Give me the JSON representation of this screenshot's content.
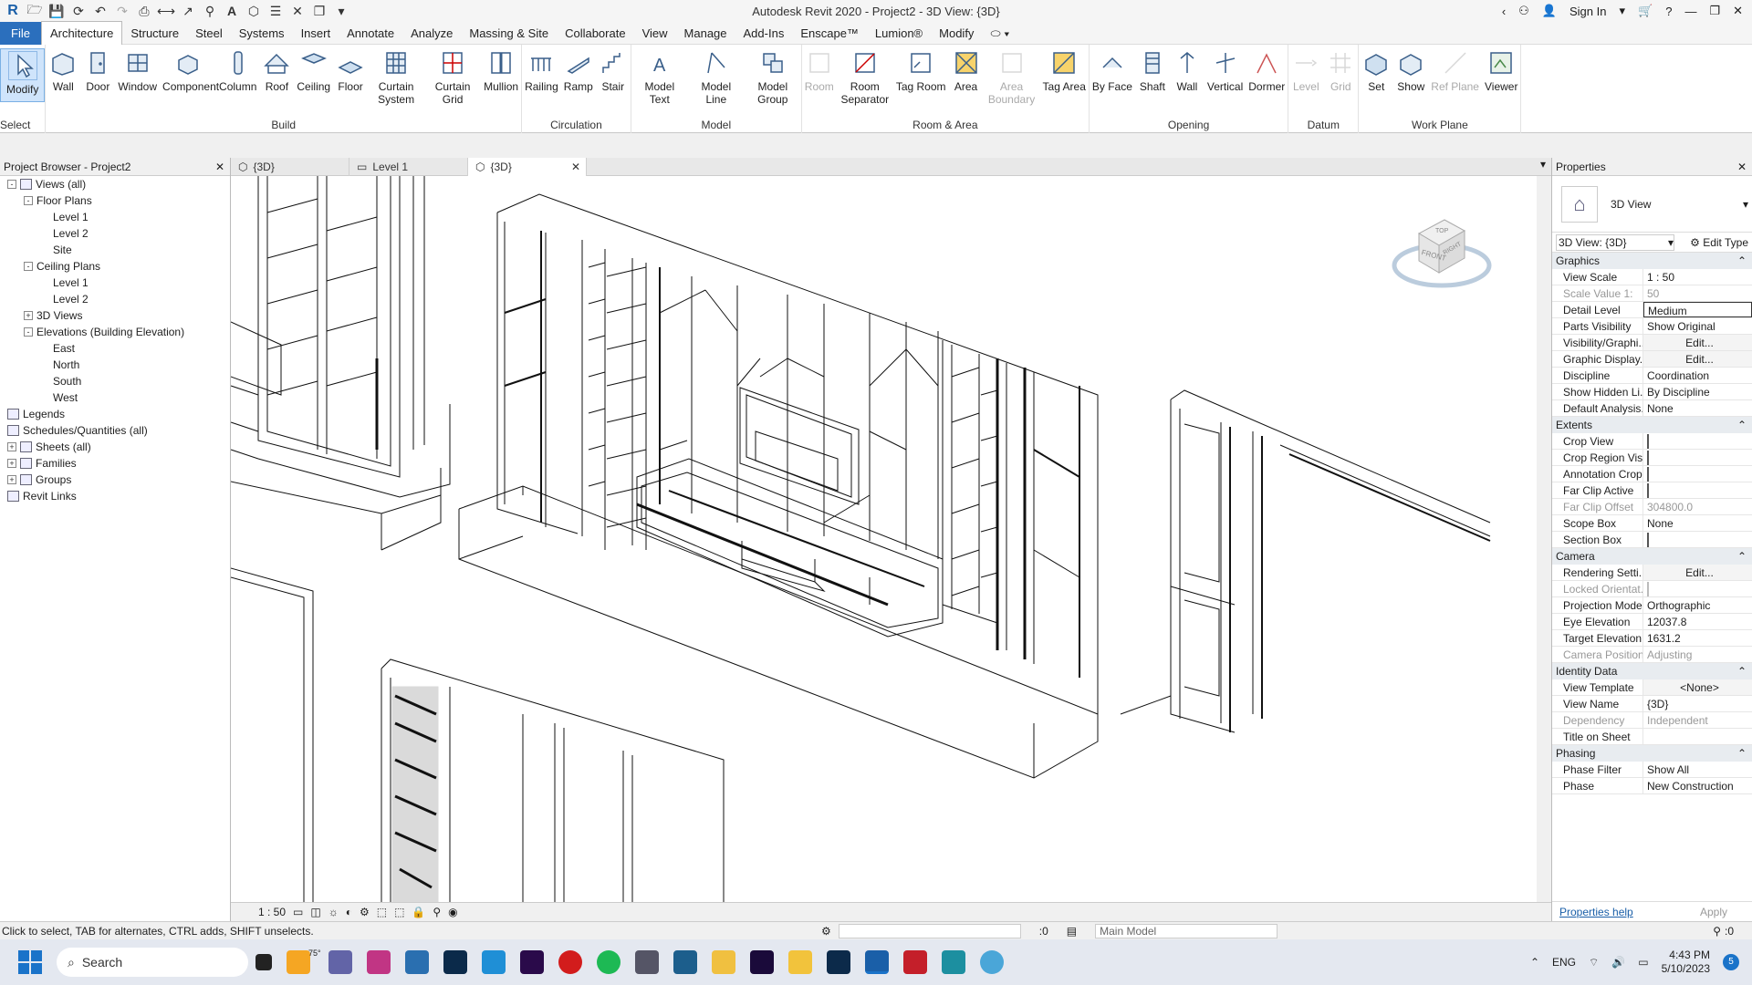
{
  "app_title": "Autodesk Revit 2020 - Project2 - 3D View: {3D}",
  "signin": "Sign In",
  "menu": [
    "File",
    "Architecture",
    "Structure",
    "Steel",
    "Systems",
    "Insert",
    "Annotate",
    "Analyze",
    "Massing & Site",
    "Collaborate",
    "View",
    "Manage",
    "Add-Ins",
    "Enscape™",
    "Lumion®",
    "Modify"
  ],
  "ribbon": {
    "select_label": "Select",
    "panels": [
      {
        "name": "",
        "tools": [
          {
            "label": "Modify",
            "icon": "cursor-icon"
          }
        ]
      },
      {
        "name": "Build",
        "tools": [
          {
            "label": "Wall",
            "icon": "wall-icon"
          },
          {
            "label": "Door",
            "icon": "door-icon"
          },
          {
            "label": "Window",
            "icon": "window-icon"
          },
          {
            "label": "Component",
            "icon": "component-icon"
          },
          {
            "label": "Column",
            "icon": "column-icon"
          },
          {
            "label": "Roof",
            "icon": "roof-icon"
          },
          {
            "label": "Ceiling",
            "icon": "ceiling-icon"
          },
          {
            "label": "Floor",
            "icon": "floor-icon"
          },
          {
            "label": "Curtain System",
            "icon": "curtain-system-icon"
          },
          {
            "label": "Curtain Grid",
            "icon": "curtain-grid-icon"
          },
          {
            "label": "Mullion",
            "icon": "mullion-icon"
          }
        ]
      },
      {
        "name": "Circulation",
        "tools": [
          {
            "label": "Railing",
            "icon": "railing-icon"
          },
          {
            "label": "Ramp",
            "icon": "ramp-icon"
          },
          {
            "label": "Stair",
            "icon": "stair-icon"
          }
        ]
      },
      {
        "name": "Model",
        "tools": [
          {
            "label": "Model Text",
            "icon": "model-text-icon"
          },
          {
            "label": "Model Line",
            "icon": "model-line-icon"
          },
          {
            "label": "Model Group",
            "icon": "model-group-icon"
          }
        ]
      },
      {
        "name": "Room & Area",
        "tools": [
          {
            "label": "Room",
            "icon": "room-icon",
            "disabled": true
          },
          {
            "label": "Room Separator",
            "icon": "room-separator-icon"
          },
          {
            "label": "Tag Room",
            "icon": "tag-room-icon"
          },
          {
            "label": "Area",
            "icon": "area-icon"
          },
          {
            "label": "Area Boundary",
            "icon": "area-boundary-icon",
            "disabled": true
          },
          {
            "label": "Tag Area",
            "icon": "tag-area-icon"
          }
        ]
      },
      {
        "name": "Opening",
        "tools": [
          {
            "label": "By Face",
            "icon": "by-face-icon"
          },
          {
            "label": "Shaft",
            "icon": "shaft-icon"
          },
          {
            "label": "Wall",
            "icon": "wall-opening-icon"
          },
          {
            "label": "Vertical",
            "icon": "vertical-icon"
          },
          {
            "label": "Dormer",
            "icon": "dormer-icon"
          }
        ]
      },
      {
        "name": "Datum",
        "tools": [
          {
            "label": "Level",
            "icon": "level-icon",
            "disabled": true
          },
          {
            "label": "Grid",
            "icon": "grid-icon",
            "disabled": true
          }
        ]
      },
      {
        "name": "Work Plane",
        "tools": [
          {
            "label": "Set",
            "icon": "set-icon"
          },
          {
            "label": "Show",
            "icon": "show-icon"
          },
          {
            "label": "Ref Plane",
            "icon": "ref-plane-icon",
            "disabled": true
          },
          {
            "label": "Viewer",
            "icon": "viewer-icon"
          }
        ]
      }
    ]
  },
  "browser": {
    "title": "Project Browser - Project2",
    "items": [
      {
        "label": "Views (all)",
        "level": 0,
        "toggle": "-"
      },
      {
        "label": "Floor Plans",
        "level": 1,
        "toggle": "-"
      },
      {
        "label": "Level 1",
        "level": 2
      },
      {
        "label": "Level 2",
        "level": 2
      },
      {
        "label": "Site",
        "level": 2
      },
      {
        "label": "Ceiling Plans",
        "level": 1,
        "toggle": "-"
      },
      {
        "label": "Level 1",
        "level": 2
      },
      {
        "label": "Level 2",
        "level": 2
      },
      {
        "label": "3D Views",
        "level": 1,
        "toggle": "+"
      },
      {
        "label": "Elevations (Building Elevation)",
        "level": 1,
        "toggle": "-"
      },
      {
        "label": "East",
        "level": 2
      },
      {
        "label": "North",
        "level": 2
      },
      {
        "label": "South",
        "level": 2
      },
      {
        "label": "West",
        "level": 2
      },
      {
        "label": "Legends",
        "level": 0,
        "icon": true
      },
      {
        "label": "Schedules/Quantities (all)",
        "level": 0,
        "icon": true
      },
      {
        "label": "Sheets (all)",
        "level": 0,
        "icon": true,
        "toggle": "+"
      },
      {
        "label": "Families",
        "level": 0,
        "icon": true,
        "toggle": "+"
      },
      {
        "label": "Groups",
        "level": 0,
        "icon": true,
        "toggle": "+"
      },
      {
        "label": "Revit Links",
        "level": 0,
        "icon": true
      }
    ]
  },
  "view_tabs": [
    "{3D}",
    "Level 1",
    "{3D}"
  ],
  "view_scale": "1 : 50",
  "properties": {
    "title": "Properties",
    "type_name": "3D View",
    "selector": "3D View: {3D}",
    "edit_type": "Edit Type",
    "sections": [
      {
        "name": "Graphics",
        "rows": [
          {
            "k": "View Scale",
            "v": "1 : 50"
          },
          {
            "k": "Scale Value    1:",
            "v": "50",
            "dis": true
          },
          {
            "k": "Detail Level",
            "v": "Medium"
          },
          {
            "k": "Parts Visibility",
            "v": "Show Original"
          },
          {
            "k": "Visibility/Graphi...",
            "v": "Edit...",
            "btn": true
          },
          {
            "k": "Graphic Display...",
            "v": "Edit...",
            "btn": true
          },
          {
            "k": "Discipline",
            "v": "Coordination"
          },
          {
            "k": "Show Hidden Li...",
            "v": "By Discipline"
          },
          {
            "k": "Default Analysis...",
            "v": "None"
          }
        ]
      },
      {
        "name": "Extents",
        "rows": [
          {
            "k": "Crop View",
            "v": "",
            "cb": true
          },
          {
            "k": "Crop Region Vis...",
            "v": "",
            "cb": true
          },
          {
            "k": "Annotation Crop",
            "v": "",
            "cb": true
          },
          {
            "k": "Far Clip Active",
            "v": "",
            "cb": true
          },
          {
            "k": "Far Clip Offset",
            "v": "304800.0",
            "dis": true
          },
          {
            "k": "Scope Box",
            "v": "None"
          },
          {
            "k": "Section Box",
            "v": "",
            "cb": true
          }
        ]
      },
      {
        "name": "Camera",
        "rows": [
          {
            "k": "Rendering Setti...",
            "v": "Edit...",
            "btn": true
          },
          {
            "k": "Locked Orientat...",
            "v": "",
            "cb": true,
            "dis": true
          },
          {
            "k": "Projection Mode",
            "v": "Orthographic"
          },
          {
            "k": "Eye Elevation",
            "v": "12037.8"
          },
          {
            "k": "Target Elevation",
            "v": "1631.2"
          },
          {
            "k": "Camera Position",
            "v": "Adjusting",
            "dis": true
          }
        ]
      },
      {
        "name": "Identity Data",
        "rows": [
          {
            "k": "View Template",
            "v": "<None>",
            "btn": true
          },
          {
            "k": "View Name",
            "v": "{3D}"
          },
          {
            "k": "Dependency",
            "v": "Independent",
            "dis": true
          },
          {
            "k": "Title on Sheet",
            "v": ""
          }
        ]
      },
      {
        "name": "Phasing",
        "rows": [
          {
            "k": "Phase Filter",
            "v": "Show All"
          },
          {
            "k": "Phase",
            "v": "New Construction"
          }
        ]
      }
    ],
    "help": "Properties help",
    "apply": "Apply"
  },
  "status": {
    "text": "Click to select, TAB for alternates, CTRL adds, SHIFT unselects.",
    "sel_count": ":0",
    "model": "Main Model",
    "filter": ":0"
  },
  "taskbar": {
    "search": "Search",
    "lang": "ENG",
    "time": "4:43 PM",
    "date": "5/10/2023",
    "temp": "75°",
    "notif": "5"
  },
  "viewcube": {
    "top": "TOP",
    "front": "FRONT",
    "right": "RIGHT"
  }
}
